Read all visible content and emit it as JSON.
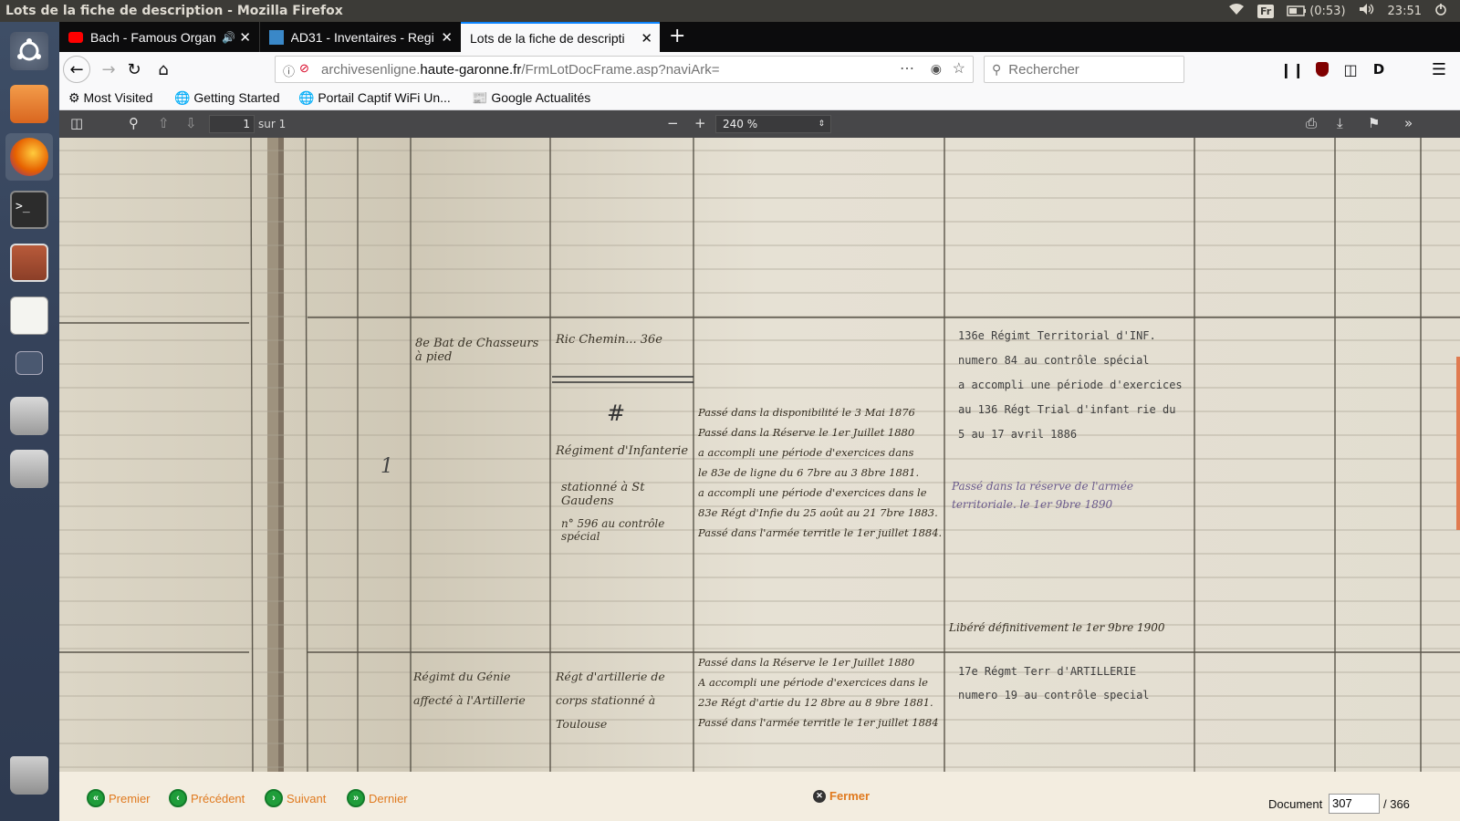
{
  "window": {
    "title": "Lots de la fiche de description - Mozilla Firefox"
  },
  "tray": {
    "keyboard": "Fr",
    "battery": "(0:53)",
    "clock": "23:51"
  },
  "tabs": [
    {
      "label": "Bach - Famous Organ"
    },
    {
      "label": "AD31 - Inventaires - Regi"
    },
    {
      "label": "Lots de la fiche de descripti"
    }
  ],
  "address": {
    "url_pre": "archivesenligne.",
    "url_domain": "haute-garonne.fr",
    "url_post": "/FrmLotDocFrame.asp?naviArk="
  },
  "search": {
    "placeholder": "Rechercher"
  },
  "bookmarks": [
    {
      "label": "Most Visited"
    },
    {
      "label": "Getting Started"
    },
    {
      "label": "Portail Captif WiFi Un..."
    },
    {
      "label": "Google Actualités"
    }
  ],
  "pdf": {
    "page": "1",
    "of": "sur 1",
    "zoom": "240 %"
  },
  "document": {
    "row1": {
      "col2": "8e Bat de Chasseurs à pied",
      "col3a": "Ric Chemin... 36e",
      "col3b": "Régiment d'Infanterie",
      "col3c": "stationné à St Gaudens",
      "col3d": "n° 596 au contrôle spécial",
      "col4": [
        "Passé dans la disponibilité le 3 Mai 1876",
        "Passé dans la Réserve le 1er Juillet 1880",
        "a accompli une période d'exercices dans",
        "le 83e de ligne du 6 7bre au 3 8bre 1881.",
        "a accompli une période d'exercices dans le",
        "83e Régt d'Infie du 25 août au 21 7bre 1883.",
        "Passé dans l'armée territle le 1er juillet 1884."
      ],
      "col5": [
        "136e Régimt Territorial d'INF.",
        "numero 84 au contrôle spécial",
        "a accompli une période d'exercices",
        "au 136 Régt Trial d'infant rie du",
        "5 au 17 avril 1886"
      ],
      "col5b": "Passé dans la réserve de l'armée territoriale. le 1er 9bre 1890",
      "col1num": "1"
    },
    "row2": {
      "col2": "Régimt du Génie affecté à l'Artillerie",
      "col3": "Régt d'artillerie de corps stationné à Toulouse",
      "col4": [
        "Passé dans la Réserve le 1er Juillet 1880",
        "A accompli une période d'exercices dans le",
        "23e Régt d'artie du 12 8bre au 8 9bre 1881.",
        "Passé dans l'armée territle le 1er juillet 1884"
      ],
      "col5": [
        "17e Régmt Terr d'ARTILLERIE",
        "numero 19 au contrôle special"
      ],
      "col5top": "Libéré définitivement le 1er 9bre 1900"
    }
  },
  "bottom": {
    "first": "Premier",
    "prev": "Précédent",
    "next": "Suivant",
    "last": "Dernier",
    "close": "Fermer",
    "doc_label": "Document",
    "doc_value": "307",
    "doc_total": "/ 366"
  }
}
